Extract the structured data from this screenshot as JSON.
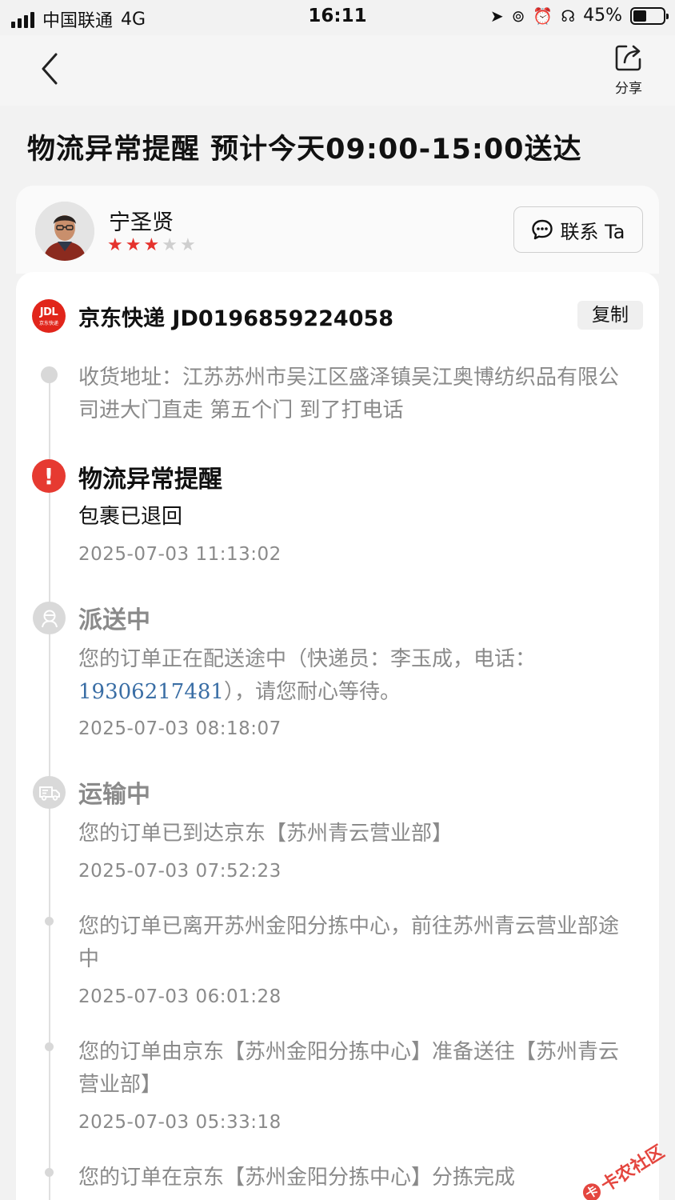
{
  "status_bar": {
    "carrier": "中国联通",
    "network": "4G",
    "time": "16:11",
    "battery": "45%",
    "battery_level": 0.45
  },
  "nav": {
    "share_label": "分享"
  },
  "page_title": "物流异常提醒 预计今天09:00-15:00送达",
  "courier": {
    "name": "宁圣贤",
    "rating": 3,
    "rating_max": 5,
    "contact_label": "联系 Ta"
  },
  "carrier": {
    "logo_text": "JDL",
    "logo_sub": "京东快递",
    "name_tracking": "京东快递 JD0196859224058",
    "copy_label": "复制"
  },
  "timeline": {
    "address": "收货地址：江苏苏州市吴江区盛泽镇吴江奥博纺织品有限公司进大门直走 第五个门 到了打电话",
    "exception": {
      "title": "物流异常提醒",
      "text": "包裹已退回",
      "time": "2025-07-03 11:13:02"
    },
    "delivering": {
      "title": "派送中",
      "text_before": "您的订单正在配送途中（快递员：李玉成，电话：",
      "phone": "19306217481",
      "text_after": "），请您耐心等待。",
      "time": "2025-07-03 08:18:07"
    },
    "transit": {
      "title": "运输中",
      "text": "您的订单已到达京东【苏州青云营业部】",
      "time": "2025-07-03 07:52:23"
    },
    "events": [
      {
        "text": "您的订单已离开苏州金阳分拣中心，前往苏州青云营业部途中",
        "time": "2025-07-03 06:01:28"
      },
      {
        "text": "您的订单由京东【苏州金阳分拣中心】准备送往【苏州青云营业部】",
        "time": "2025-07-03 05:33:18"
      },
      {
        "text": "您的订单在京东【苏州金阳分拣中心】分拣完成",
        "time": ""
      }
    ]
  },
  "watermark": "卡农社区",
  "colors": {
    "accent_red": "#e63a31",
    "star_on": "#e5322d",
    "link_blue": "#3a6ea5",
    "muted_text": "#8a8a8a"
  }
}
